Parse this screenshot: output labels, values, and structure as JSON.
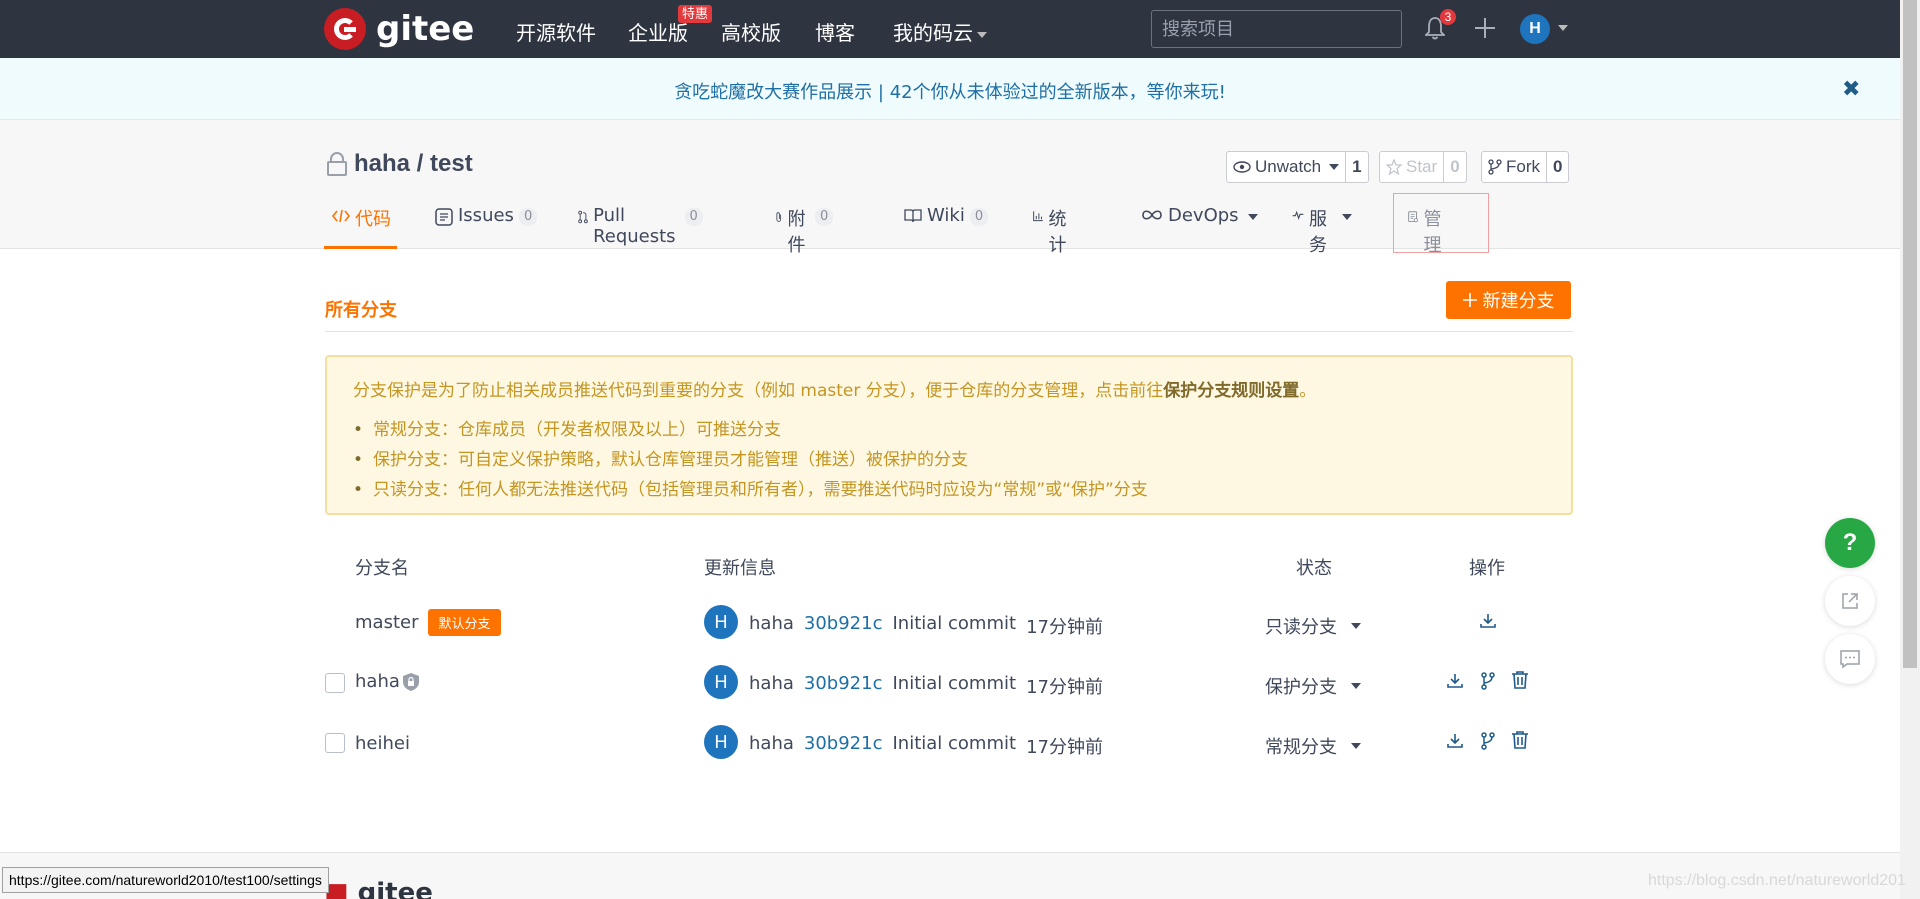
{
  "nav": {
    "logo_text": "gitee",
    "links": [
      "开源软件",
      "企业版",
      "高校版",
      "博客",
      "我的码云"
    ],
    "enterprise_badge": "特惠",
    "search_placeholder": "搜索项目",
    "notification_count": "3",
    "avatar_letter": "H"
  },
  "announcement": {
    "text": "贪吃蛇魔改大赛作品展示 | 42个你从未体验过的全新版本，等你来玩!",
    "close": "✖"
  },
  "repo": {
    "owner": "haha",
    "separator": " / ",
    "name": "test",
    "unwatch_label": "Unwatch",
    "unwatch_count": "1",
    "star_label": "Star",
    "star_count": "0",
    "fork_label": "Fork",
    "fork_count": "0"
  },
  "tabs": [
    {
      "label": "代码",
      "count": ""
    },
    {
      "label": "Issues",
      "count": "0"
    },
    {
      "label": "Pull Requests",
      "count": "0"
    },
    {
      "label": "附件",
      "count": "0"
    },
    {
      "label": "Wiki",
      "count": "0"
    },
    {
      "label": "统计",
      "count": ""
    },
    {
      "label": "DevOps",
      "count": ""
    },
    {
      "label": "服务",
      "count": ""
    },
    {
      "label": "管理",
      "count": ""
    }
  ],
  "branches_page": {
    "title": "所有分支",
    "new_branch_label": "新建分支",
    "notice": {
      "intro_prefix": "分支保护是为了防止相关成员推送代码到重要的分支（例如 master 分支），便于仓库的分支管理，点击前往",
      "intro_link": "保护分支规则设置",
      "intro_suffix": "。",
      "items": [
        "常规分支：仓库成员（开发者权限及以上）可推送分支",
        "保护分支：可自定义保护策略，默认仓库管理员才能管理（推送）被保护的分支",
        "只读分支：任何人都无法推送代码（包括管理员和所有者），需要推送代码时应设为“常规”或“保护”分支"
      ]
    },
    "columns": [
      "分支名",
      "更新信息",
      "状态",
      "操作"
    ],
    "rows": [
      {
        "name": "master",
        "tag": "默认分支",
        "avatar": "H",
        "author": "haha",
        "sha": "30b921c",
        "message": "Initial commit",
        "time": "17分钟前",
        "status": "只读分支"
      },
      {
        "name": "haha",
        "tag": "",
        "avatar": "H",
        "author": "haha",
        "sha": "30b921c",
        "message": "Initial commit",
        "time": "17分钟前",
        "status": "保护分支"
      },
      {
        "name": "heihei",
        "tag": "",
        "avatar": "H",
        "author": "haha",
        "sha": "30b921c",
        "message": "Initial commit",
        "time": "17分钟前",
        "status": "常规分支"
      }
    ]
  },
  "floating": {
    "help": "?"
  },
  "footer": {
    "logo_text": "gitee"
  },
  "statusbar": {
    "url": "https://gitee.com/natureworld2010/test100/settings"
  },
  "watermark": "https://blog.csdn.net/natureworld201"
}
